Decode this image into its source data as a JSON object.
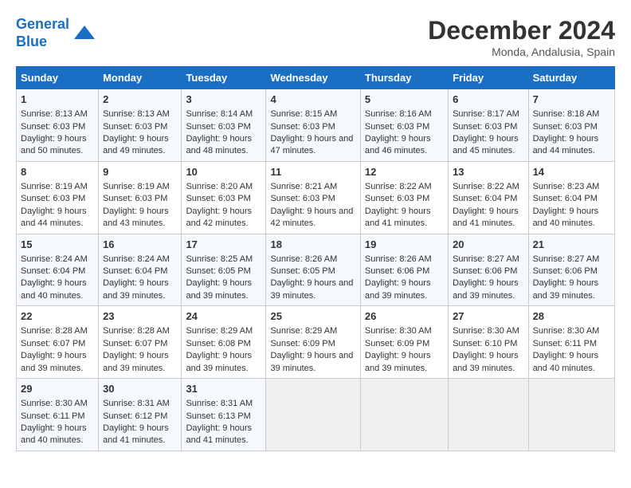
{
  "logo": {
    "line1": "General",
    "line2": "Blue"
  },
  "title": "December 2024",
  "subtitle": "Monda, Andalusia, Spain",
  "days_of_week": [
    "Sunday",
    "Monday",
    "Tuesday",
    "Wednesday",
    "Thursday",
    "Friday",
    "Saturday"
  ],
  "weeks": [
    [
      {
        "day": "1",
        "sunrise": "8:13 AM",
        "sunset": "6:03 PM",
        "daylight": "9 hours and 50 minutes."
      },
      {
        "day": "2",
        "sunrise": "8:13 AM",
        "sunset": "6:03 PM",
        "daylight": "9 hours and 49 minutes."
      },
      {
        "day": "3",
        "sunrise": "8:14 AM",
        "sunset": "6:03 PM",
        "daylight": "9 hours and 48 minutes."
      },
      {
        "day": "4",
        "sunrise": "8:15 AM",
        "sunset": "6:03 PM",
        "daylight": "9 hours and 47 minutes."
      },
      {
        "day": "5",
        "sunrise": "8:16 AM",
        "sunset": "6:03 PM",
        "daylight": "9 hours and 46 minutes."
      },
      {
        "day": "6",
        "sunrise": "8:17 AM",
        "sunset": "6:03 PM",
        "daylight": "9 hours and 45 minutes."
      },
      {
        "day": "7",
        "sunrise": "8:18 AM",
        "sunset": "6:03 PM",
        "daylight": "9 hours and 44 minutes."
      }
    ],
    [
      {
        "day": "8",
        "sunrise": "8:19 AM",
        "sunset": "6:03 PM",
        "daylight": "9 hours and 44 minutes."
      },
      {
        "day": "9",
        "sunrise": "8:19 AM",
        "sunset": "6:03 PM",
        "daylight": "9 hours and 43 minutes."
      },
      {
        "day": "10",
        "sunrise": "8:20 AM",
        "sunset": "6:03 PM",
        "daylight": "9 hours and 42 minutes."
      },
      {
        "day": "11",
        "sunrise": "8:21 AM",
        "sunset": "6:03 PM",
        "daylight": "9 hours and 42 minutes."
      },
      {
        "day": "12",
        "sunrise": "8:22 AM",
        "sunset": "6:03 PM",
        "daylight": "9 hours and 41 minutes."
      },
      {
        "day": "13",
        "sunrise": "8:22 AM",
        "sunset": "6:04 PM",
        "daylight": "9 hours and 41 minutes."
      },
      {
        "day": "14",
        "sunrise": "8:23 AM",
        "sunset": "6:04 PM",
        "daylight": "9 hours and 40 minutes."
      }
    ],
    [
      {
        "day": "15",
        "sunrise": "8:24 AM",
        "sunset": "6:04 PM",
        "daylight": "9 hours and 40 minutes."
      },
      {
        "day": "16",
        "sunrise": "8:24 AM",
        "sunset": "6:04 PM",
        "daylight": "9 hours and 39 minutes."
      },
      {
        "day": "17",
        "sunrise": "8:25 AM",
        "sunset": "6:05 PM",
        "daylight": "9 hours and 39 minutes."
      },
      {
        "day": "18",
        "sunrise": "8:26 AM",
        "sunset": "6:05 PM",
        "daylight": "9 hours and 39 minutes."
      },
      {
        "day": "19",
        "sunrise": "8:26 AM",
        "sunset": "6:06 PM",
        "daylight": "9 hours and 39 minutes."
      },
      {
        "day": "20",
        "sunrise": "8:27 AM",
        "sunset": "6:06 PM",
        "daylight": "9 hours and 39 minutes."
      },
      {
        "day": "21",
        "sunrise": "8:27 AM",
        "sunset": "6:06 PM",
        "daylight": "9 hours and 39 minutes."
      }
    ],
    [
      {
        "day": "22",
        "sunrise": "8:28 AM",
        "sunset": "6:07 PM",
        "daylight": "9 hours and 39 minutes."
      },
      {
        "day": "23",
        "sunrise": "8:28 AM",
        "sunset": "6:07 PM",
        "daylight": "9 hours and 39 minutes."
      },
      {
        "day": "24",
        "sunrise": "8:29 AM",
        "sunset": "6:08 PM",
        "daylight": "9 hours and 39 minutes."
      },
      {
        "day": "25",
        "sunrise": "8:29 AM",
        "sunset": "6:09 PM",
        "daylight": "9 hours and 39 minutes."
      },
      {
        "day": "26",
        "sunrise": "8:30 AM",
        "sunset": "6:09 PM",
        "daylight": "9 hours and 39 minutes."
      },
      {
        "day": "27",
        "sunrise": "8:30 AM",
        "sunset": "6:10 PM",
        "daylight": "9 hours and 39 minutes."
      },
      {
        "day": "28",
        "sunrise": "8:30 AM",
        "sunset": "6:11 PM",
        "daylight": "9 hours and 40 minutes."
      }
    ],
    [
      {
        "day": "29",
        "sunrise": "8:30 AM",
        "sunset": "6:11 PM",
        "daylight": "9 hours and 40 minutes."
      },
      {
        "day": "30",
        "sunrise": "8:31 AM",
        "sunset": "6:12 PM",
        "daylight": "9 hours and 41 minutes."
      },
      {
        "day": "31",
        "sunrise": "8:31 AM",
        "sunset": "6:13 PM",
        "daylight": "9 hours and 41 minutes."
      },
      null,
      null,
      null,
      null
    ]
  ],
  "labels": {
    "sunrise": "Sunrise:",
    "sunset": "Sunset:",
    "daylight": "Daylight:"
  }
}
